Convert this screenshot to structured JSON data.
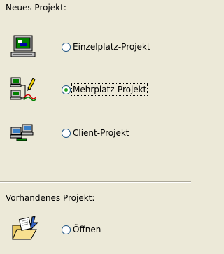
{
  "new_project": {
    "heading": "Neues Projekt:",
    "options": [
      {
        "label": "Einzelplatz-Projekt",
        "checked": false,
        "icon": "computer-icon"
      },
      {
        "label": "Mehrplatz-Projekt",
        "checked": true,
        "icon": "network-computers-icon"
      },
      {
        "label": "Client-Projekt",
        "checked": false,
        "icon": "client-computers-icon"
      }
    ]
  },
  "existing_project": {
    "heading": "Vorhandenes Projekt:",
    "open_label": "Öffnen",
    "open_checked": false,
    "icon": "open-folder-icon"
  },
  "colors": {
    "background": "#ece9d8",
    "radio_border": "#1c5180",
    "radio_dot": "#21a121"
  }
}
